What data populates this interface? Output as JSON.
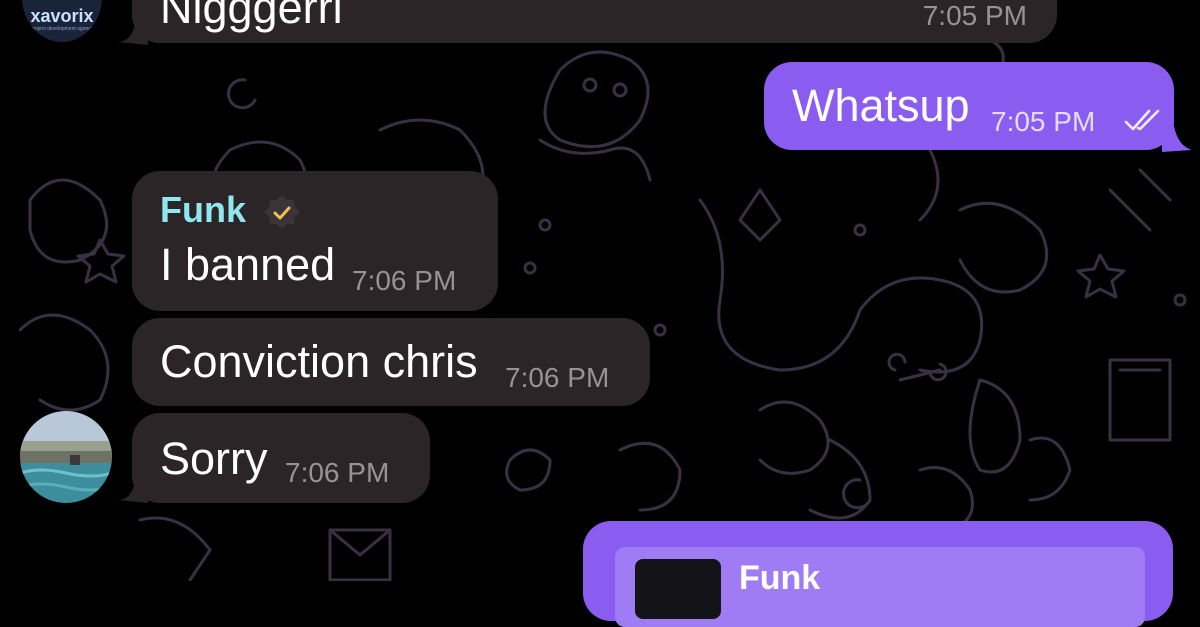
{
  "chat": {
    "messages": [
      {
        "sender": "",
        "text": "Nigggerri",
        "time": "7:05 PM",
        "direction": "in"
      },
      {
        "sender": "",
        "text": "Whatsup",
        "time": "7:05 PM",
        "direction": "out",
        "status": "read"
      },
      {
        "sender": "Funk",
        "text": "I banned",
        "time": "7:06 PM",
        "direction": "in",
        "verified": true
      },
      {
        "sender": "",
        "text": "Conviction chris",
        "time": "7:06 PM",
        "direction": "in"
      },
      {
        "sender": "",
        "text": "Sorry",
        "time": "7:06 PM",
        "direction": "in"
      }
    ],
    "reply_preview": {
      "sender": "Funk"
    },
    "top_avatar": {
      "label": "xavorix",
      "sublabel": "project development agency"
    }
  },
  "colors": {
    "background": "#000000",
    "incoming_bubble": "#2c2528",
    "outgoing_bubble": "#8a5cf0",
    "sender_name": "#8ee8ee",
    "doodle_stroke": "#3a2f44"
  },
  "icons": {
    "read_receipt": "double-check-icon",
    "verified": "verified-badge-icon"
  }
}
